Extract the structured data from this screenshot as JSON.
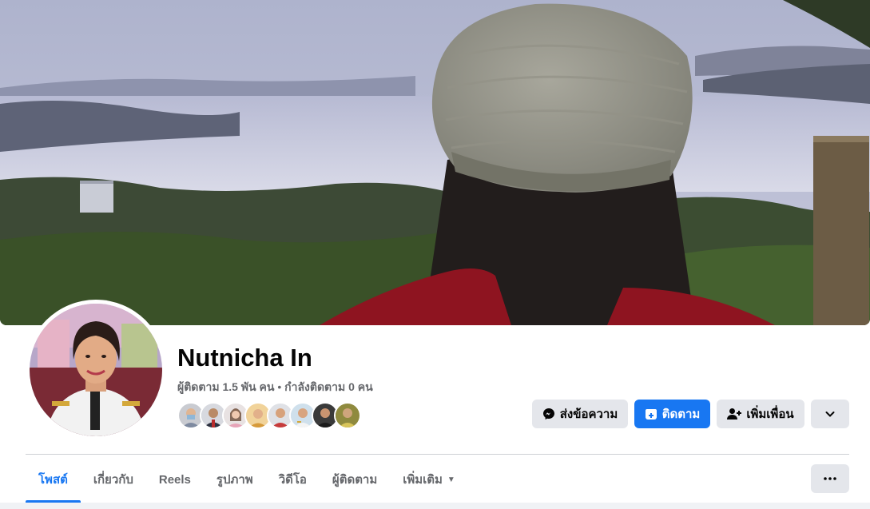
{
  "profile": {
    "name": "Nutnicha In",
    "followers_text": "ผู้ติดตาม 1.5 พัน คน",
    "separator": " • ",
    "following_text": "กำลังติดตาม 0 คน"
  },
  "friends_preview_count": 8,
  "actions": {
    "message_label": "ส่งข้อความ",
    "follow_label": "ติดตาม",
    "add_friend_label": "เพิ่มเพื่อน"
  },
  "tabs": [
    {
      "label": "โพสต์",
      "active": true
    },
    {
      "label": "เกี่ยวกับ",
      "active": false
    },
    {
      "label": "Reels",
      "active": false
    },
    {
      "label": "รูปภาพ",
      "active": false
    },
    {
      "label": "วิดีโอ",
      "active": false
    },
    {
      "label": "ผู้ติดตาม",
      "active": false
    },
    {
      "label": "เพิ่มเติม",
      "active": false
    }
  ],
  "icons": {
    "message": "messenger-icon",
    "follow": "follow-plus-icon",
    "add_friend": "add-friend-icon",
    "dropdown": "chevron-down-icon",
    "more_tab": "caret-down-icon",
    "overflow": "more-dots-icon"
  },
  "colors": {
    "accent": "#1877f2",
    "secondary_text": "#65676b",
    "button_grey": "#e4e6eb"
  }
}
